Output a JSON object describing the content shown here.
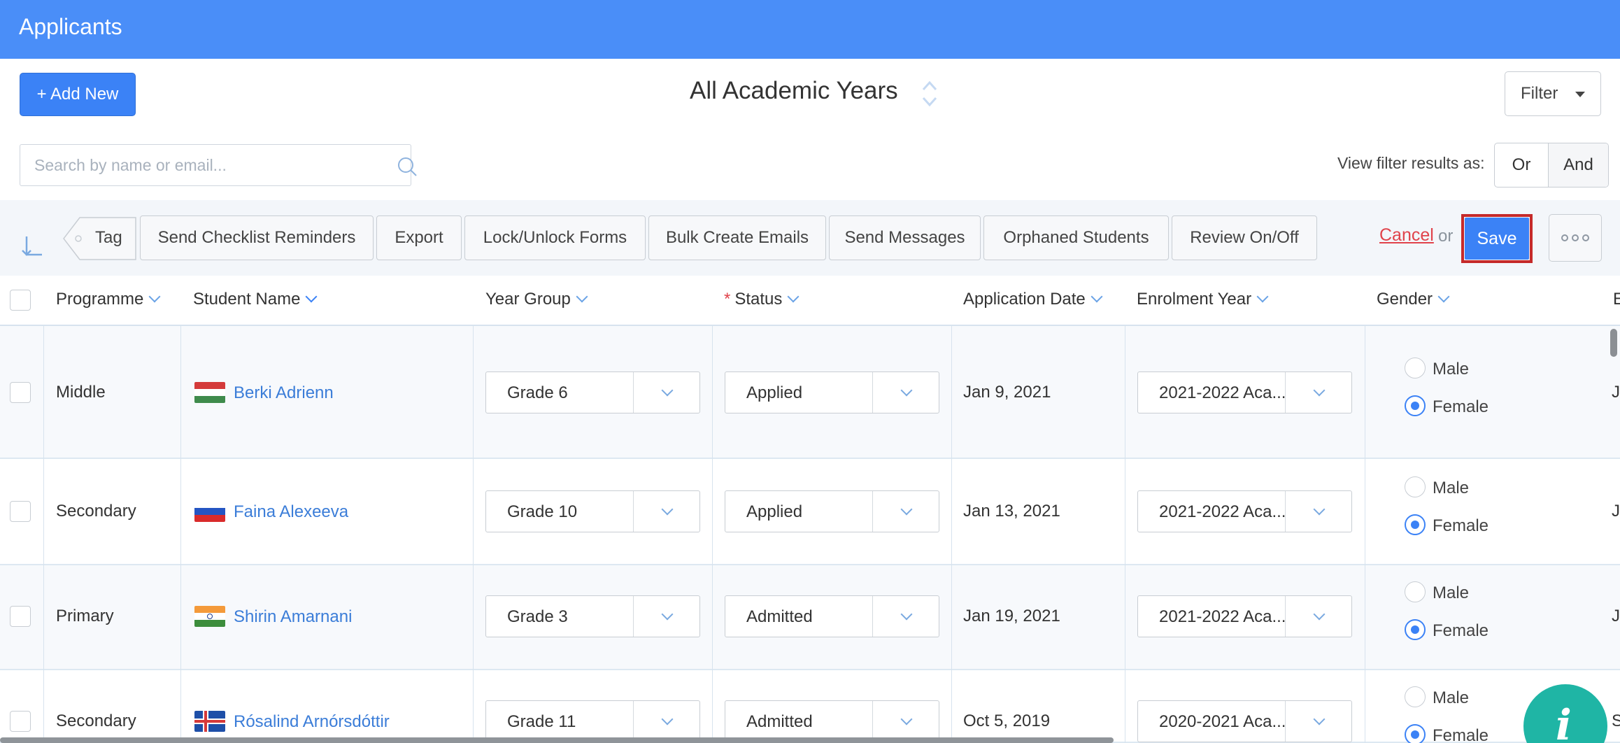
{
  "header": {
    "title": "Applicants"
  },
  "toolbar": {
    "add_label": "+ Add New",
    "year_selector": "All Academic Years",
    "filter_label": "Filter"
  },
  "search": {
    "placeholder": "Search by name or email..."
  },
  "view_filter": {
    "label": "View filter results as:",
    "or": "Or",
    "and": "And"
  },
  "actions": {
    "tag": "Tag",
    "buttons": [
      "Send Checklist Reminders",
      "Export",
      "Lock/Unlock Forms",
      "Bulk Create Emails",
      "Send Messages",
      "Orphaned Students",
      "Review On/Off"
    ],
    "cancel": "Cancel",
    "or": "or",
    "save": "Save"
  },
  "columns": {
    "programme": "Programme",
    "student_name": "Student Name",
    "year_group": "Year Group",
    "status_required": "*",
    "status": "Status",
    "application_date": "Application Date",
    "enrolment_year": "Enrolment Year",
    "gender": "Gender",
    "next_partial": "E"
  },
  "rows": [
    {
      "programme": "Middle",
      "flag": "hungary-flag-icon",
      "name": "Berki Adrienn",
      "year_group": "Grade 6",
      "status": "Applied",
      "date": "Jan 9, 2021",
      "enrolment": "2021-2022 Aca...",
      "gender_male": "Male",
      "gender_female": "Female",
      "selected_gender": "Female",
      "edge": "J"
    },
    {
      "programme": "Secondary",
      "flag": "russia-flag-icon",
      "name": "Faina Alexeeva",
      "year_group": "Grade 10",
      "status": "Applied",
      "date": "Jan 13, 2021",
      "enrolment": "2021-2022 Aca...",
      "gender_male": "Male",
      "gender_female": "Female",
      "selected_gender": "Female",
      "edge": "J"
    },
    {
      "programme": "Primary",
      "flag": "india-flag-icon",
      "name": "Shirin Amarnani",
      "year_group": "Grade 3",
      "status": "Admitted",
      "date": "Jan 19, 2021",
      "enrolment": "2021-2022 Aca...",
      "gender_male": "Male",
      "gender_female": "Female",
      "selected_gender": "Female",
      "edge": "J"
    },
    {
      "programme": "Secondary",
      "flag": "iceland-flag-icon",
      "name": "Rósalind Arnórsdóttir",
      "year_group": "Grade 11",
      "status": "Admitted",
      "date": "Oct 5, 2019",
      "enrolment": "2020-2021 Aca...",
      "gender_male": "Male",
      "gender_female": "Female",
      "selected_gender": "Female",
      "edge": "S"
    }
  ],
  "colors": {
    "header": "#4a8ef8",
    "primary": "#3b82f6",
    "link": "#3b7dd8",
    "cancel": "#e0434b",
    "save_highlight": "#c52a2a",
    "help": "#1fb5a5"
  },
  "icons": {
    "search": "search-icon",
    "collapse": "collapse-arrow-icon",
    "more": "more-options-icon",
    "help": "info-icon",
    "year_caret": "up-down-caret-icon"
  }
}
